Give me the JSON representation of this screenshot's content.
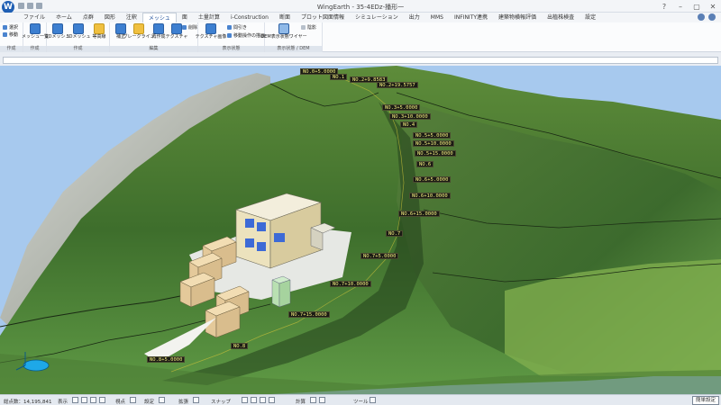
{
  "window": {
    "title": "WingEarth - 35-4EDz-播形一",
    "controls": [
      "?",
      "–",
      "▢",
      "✕"
    ]
  },
  "menu": {
    "tabs": [
      "ファイル",
      "ホーム",
      "点群",
      "図形",
      "注釈",
      "メッシュ",
      "面",
      "土量計算",
      "i-Construction",
      "断面",
      "プロット図面情報",
      "シミュレーション",
      "出力",
      "MMS",
      "INFINITY連携",
      "建築物横報評価",
      "出植株検査",
      "設定"
    ],
    "active_index": 5
  },
  "ribbon": {
    "groups": [
      {
        "name": "作成",
        "buttons": [],
        "small": [
          "選択",
          "移動"
        ]
      },
      {
        "name": "作成",
        "buttons": [
          "メッシュ一覧"
        ],
        "small": []
      },
      {
        "name": "作成",
        "buttons": [
          "2Dメッシュ",
          "3Dメッシュ",
          "等高線"
        ],
        "small": []
      },
      {
        "name": "編集",
        "buttons": [
          "補正",
          "ブレークライン",
          "再作成",
          "テクスチャ"
        ],
        "small": [
          "削除"
        ]
      },
      {
        "name": "表示状態",
        "buttons": [
          "テクスチャ画像"
        ],
        "small": [
          "間引き",
          "移動操作の描画"
        ]
      },
      {
        "name": "表示状態 / DEM",
        "buttons": [
          "DEM表示状態ワイヤー"
        ],
        "small": [
          "陰影"
        ]
      }
    ]
  },
  "stations": [
    {
      "label": "NO.0+5.0000"
    },
    {
      "label": "NO.1"
    },
    {
      "label": "NO.2+9.8583"
    },
    {
      "label": "NO.2+19.5757"
    },
    {
      "label": "NO.3+5.0000"
    },
    {
      "label": "NO.3+10.0000"
    },
    {
      "label": "NO.4"
    },
    {
      "label": "NO.5+5.0000"
    },
    {
      "label": "NO.5+10.0000"
    },
    {
      "label": "NO.5+15.0000"
    },
    {
      "label": "NO.6"
    },
    {
      "label": "NO.6+5.0000"
    },
    {
      "label": "NO.6+10.0000"
    },
    {
      "label": "NO.6+15.0000"
    },
    {
      "label": "NO.7"
    },
    {
      "label": "NO.7+5.0000"
    },
    {
      "label": "NO.7+10.0000"
    },
    {
      "label": "NO.7+15.0000"
    },
    {
      "label": "NO.8"
    },
    {
      "label": "NO.8+5.0000"
    }
  ],
  "status": {
    "point_count": "総点数：14,195,841",
    "items": [
      "表示",
      "視点",
      "設定",
      "拡張",
      "スナップ",
      "計算",
      "ツール"
    ],
    "right_button": "簡単設定"
  },
  "colors": {
    "sky": "#a7c9ee",
    "terrain_dark": "#2f5a24",
    "terrain_light": "#7fae4e",
    "station_bg": "#1a1a14",
    "station_fg": "#f5f080",
    "accent": "#1f5fb4"
  }
}
